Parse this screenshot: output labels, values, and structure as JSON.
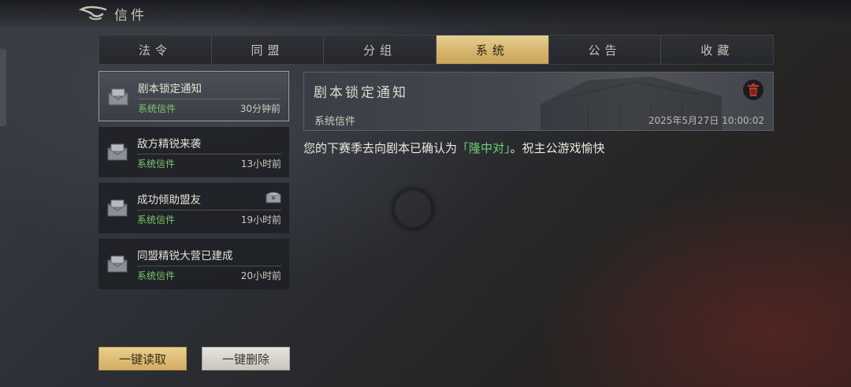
{
  "header": {
    "title": "信件"
  },
  "tabs": [
    {
      "label": "法令",
      "active": false
    },
    {
      "label": "同盟",
      "active": false
    },
    {
      "label": "分组",
      "active": false
    },
    {
      "label": "系统",
      "active": true
    },
    {
      "label": "公告",
      "active": false
    },
    {
      "label": "收藏",
      "active": false
    }
  ],
  "mails": [
    {
      "title": "剧本锁定通知",
      "sender": "系统信件",
      "time": "30分钟前",
      "selected": true,
      "has_attachment": false
    },
    {
      "title": "敌方精锐来袭",
      "sender": "系统信件",
      "time": "13小时前",
      "selected": false,
      "has_attachment": false
    },
    {
      "title": "成功倾助盟友",
      "sender": "系统信件",
      "time": "19小时前",
      "selected": false,
      "has_attachment": true
    },
    {
      "title": "同盟精锐大营已建成",
      "sender": "系统信件",
      "time": "20小时前",
      "selected": false,
      "has_attachment": false
    }
  ],
  "detail": {
    "title": "剧本锁定通知",
    "sender": "系统信件",
    "date": "2025年5月27日 10:00:02",
    "body_before": "您的下赛季去向剧本已确认为",
    "body_highlight": "「隆中对」",
    "body_after": "。祝主公游戏愉快"
  },
  "actions": {
    "read_all_label": "一键读取",
    "delete_all_label": "一键删除"
  },
  "colors": {
    "accent_gold": "#d4b26a",
    "sender_green": "#7fc56a",
    "highlight_green": "#6cd07a"
  }
}
